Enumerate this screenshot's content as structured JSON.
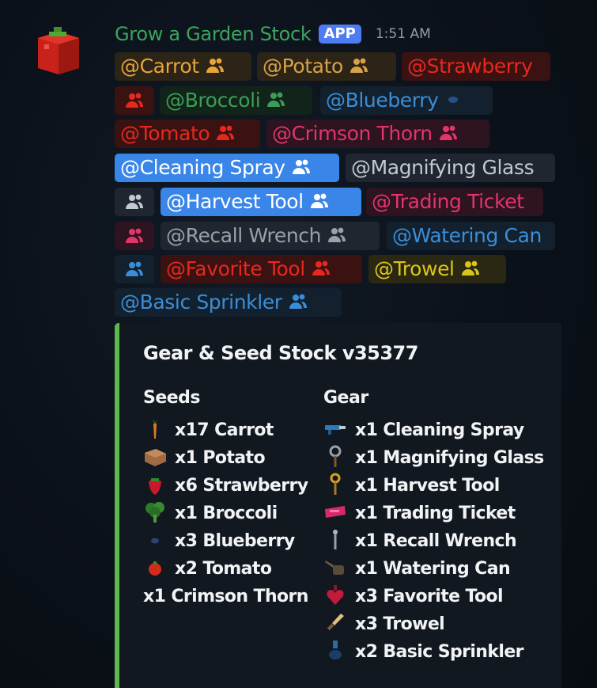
{
  "message": {
    "author": "Grow a Garden Stock",
    "badge": "APP",
    "timestamp": "1:51 AM"
  },
  "mentions": [
    {
      "label": "@Carrot",
      "color": "#e6a43a",
      "bg": "#2c2416"
    },
    {
      "label": "@Potato",
      "color": "#d8a14a",
      "bg": "#2c2416"
    },
    {
      "label": "@Strawberry",
      "color": "#e8281e",
      "bg": "#3a1212"
    },
    {
      "label": "@Broccoli",
      "color": "#3c9e56",
      "bg": "#12241a"
    },
    {
      "label": "@Blueberry",
      "color": "#3a8ed8",
      "bg": "#13202e"
    },
    {
      "label": "@Tomato",
      "color": "#e8281e",
      "bg": "#3a1212"
    },
    {
      "label": "@Crimson Thorn",
      "color": "#e2356b",
      "bg": "#2e1320"
    },
    {
      "label": "@Cleaning Spray",
      "color": "#ffffff",
      "bg": "#3a86e8"
    },
    {
      "label": "@Magnifying Glass",
      "color": "#c4c9d0",
      "bg": "#1f2630"
    },
    {
      "label": "@Harvest Tool",
      "color": "#ffffff",
      "bg": "#3a86e8"
    },
    {
      "label": "@Trading Ticket",
      "color": "#e2356b",
      "bg": "#2e1320"
    },
    {
      "label": "@Recall Wrench",
      "color": "#9aa0a8",
      "bg": "#1f2630"
    },
    {
      "label": "@Watering Can",
      "color": "#3a8ed8",
      "bg": "#13202e"
    },
    {
      "label": "@Favorite Tool",
      "color": "#e8281e",
      "bg": "#3a1212"
    },
    {
      "label": "@Trowel",
      "color": "#d9c41c",
      "bg": "#2a2712"
    },
    {
      "label": "@Basic Sprinkler",
      "color": "#3a8ed8",
      "bg": "#13202e"
    }
  ],
  "embed": {
    "title": "Gear & Seed Stock v35377",
    "accent": "#5fb84e",
    "seeds_header": "Seeds",
    "gear_header": "Gear",
    "seeds": [
      {
        "text": "x17 Carrot",
        "icon": "carrot-icon"
      },
      {
        "text": "x1 Potato",
        "icon": "potato-icon"
      },
      {
        "text": "x6 Strawberry",
        "icon": "strawberry-icon"
      },
      {
        "text": "x1 Broccoli",
        "icon": "broccoli-icon"
      },
      {
        "text": "x3 Blueberry",
        "icon": "blueberry-icon"
      },
      {
        "text": "x2 Tomato",
        "icon": "tomato-icon"
      },
      {
        "text": "x1 Crimson Thorn",
        "icon": ""
      }
    ],
    "gear": [
      {
        "text": "x1 Cleaning Spray",
        "icon": "cleaning-spray-icon"
      },
      {
        "text": "x1 Magnifying Glass",
        "icon": "magnifying-glass-icon"
      },
      {
        "text": "x1 Harvest Tool",
        "icon": "harvest-tool-icon"
      },
      {
        "text": "x1 Trading Ticket",
        "icon": "trading-ticket-icon"
      },
      {
        "text": "x1 Recall Wrench",
        "icon": "recall-wrench-icon"
      },
      {
        "text": "x1 Watering Can",
        "icon": "watering-can-icon"
      },
      {
        "text": "x3 Favorite Tool",
        "icon": "favorite-tool-icon"
      },
      {
        "text": "x3 Trowel",
        "icon": "trowel-icon"
      },
      {
        "text": "x2 Basic Sprinkler",
        "icon": "sprinkler-icon"
      }
    ]
  }
}
